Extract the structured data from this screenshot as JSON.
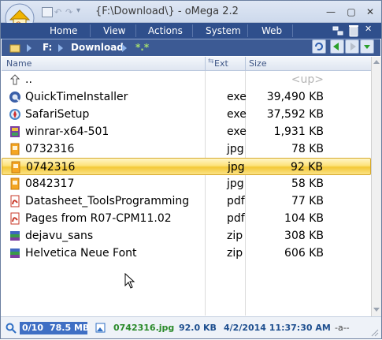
{
  "window": {
    "title": "{F:\\Download\\} - oMega 2.2"
  },
  "menu": {
    "items": [
      "Home",
      "View",
      "Actions",
      "System",
      "Web"
    ]
  },
  "pathbar": {
    "drive": "F:",
    "folder": "Download",
    "filter": "*.*"
  },
  "columns": {
    "name": "Name",
    "ext": "Ext",
    "size": "Size"
  },
  "files": [
    {
      "name": "..",
      "ext": "",
      "size": "<up>",
      "icon": "up-arrow-icon",
      "selected": false
    },
    {
      "name": "QuickTimeInstaller",
      "ext": "exe",
      "size": "39,490 KB",
      "icon": "quicktime-exe-icon",
      "selected": false
    },
    {
      "name": "SafariSetup",
      "ext": "exe",
      "size": "37,592 KB",
      "icon": "safari-exe-icon",
      "selected": false
    },
    {
      "name": "winrar-x64-501",
      "ext": "exe",
      "size": "1,931 KB",
      "icon": "winrar-exe-icon",
      "selected": false
    },
    {
      "name": "0732316",
      "ext": "jpg",
      "size": "78 KB",
      "icon": "image-file-icon",
      "selected": false
    },
    {
      "name": "0742316",
      "ext": "jpg",
      "size": "92 KB",
      "icon": "image-file-icon",
      "selected": true
    },
    {
      "name": "0842317",
      "ext": "jpg",
      "size": "58 KB",
      "icon": "image-file-icon",
      "selected": false
    },
    {
      "name": "Datasheet_ToolsProgramming",
      "ext": "pdf",
      "size": "77 KB",
      "icon": "pdf-file-icon",
      "selected": false
    },
    {
      "name": "Pages from R07-CPM11.02",
      "ext": "pdf",
      "size": "104 KB",
      "icon": "pdf-file-icon",
      "selected": false
    },
    {
      "name": "dejavu_sans",
      "ext": "zip",
      "size": "308 KB",
      "icon": "zip-archive-icon",
      "selected": false
    },
    {
      "name": "Helvetica Neue Font",
      "ext": "zip",
      "size": "606 KB",
      "icon": "zip-archive-icon",
      "selected": false
    }
  ],
  "status": {
    "count": "0/10",
    "total_size": "78.5 MB",
    "current_file": "0742316.jpg",
    "current_size": "92.0 KB",
    "datetime": "4/2/2014 11:37:30 AM",
    "attributes": "-a--"
  },
  "colors": {
    "menubar": "#2f4f8c",
    "pathbar": "#3c5a94",
    "selection": "#f3c938",
    "status_text": "#1e4f8f"
  }
}
